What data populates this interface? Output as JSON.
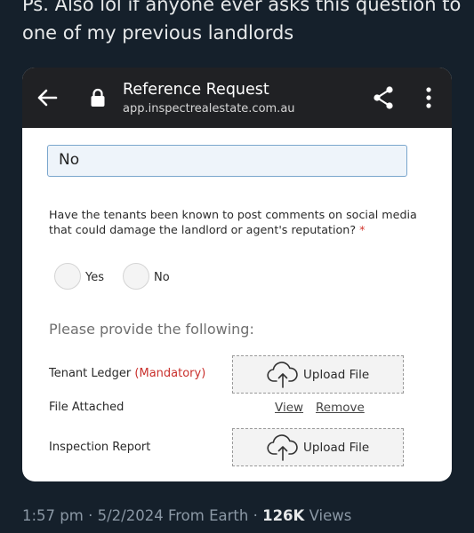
{
  "tweet": {
    "text": "Ps. Also lol if anyone ever asks this question to one of my previous landlords",
    "time": "1:57 pm",
    "date": "5/2/2024",
    "source": "From Earth",
    "views_count": "126K",
    "views_label": "Views"
  },
  "browser": {
    "title": "Reference Request",
    "url": "app.inspectrealestate.com.au",
    "icons": [
      "back-arrow-icon",
      "lock-icon",
      "share-icon",
      "more-vert-icon"
    ]
  },
  "form": {
    "previous_answer": "No",
    "question": "Have the tenants been known to post comments on social media that could damage the landlord or agent's reputation?",
    "required_marker": "*",
    "options": [
      "Yes",
      "No"
    ],
    "section_title": "Please provide the following:",
    "tenant_ledger": {
      "label": "Tenant Ledger",
      "mandatory": "(Mandatory)",
      "upload_label": "Upload File"
    },
    "file_attached": {
      "label": "File Attached",
      "view": "View",
      "remove": "Remove"
    },
    "inspection_report": {
      "label": "Inspection Report",
      "upload_label": "Upload File"
    }
  },
  "colors": {
    "background": "#15202b",
    "appbar": "#202124",
    "input_border": "#7aa6cd",
    "required": "#d0342c"
  }
}
